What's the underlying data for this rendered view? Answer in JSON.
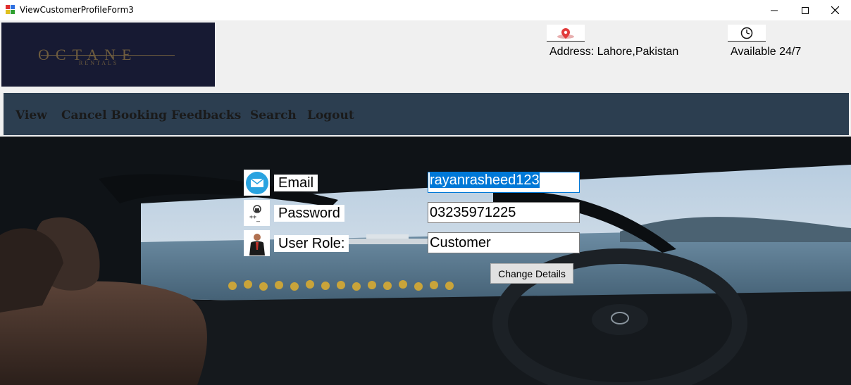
{
  "window": {
    "title": "ViewCustomerProfileForm3"
  },
  "header": {
    "logo": {
      "word": "OCTANE",
      "sub": "RENTALS"
    },
    "address_label": "Address: Lahore,Pakistan",
    "availability_label": "Available 24/7"
  },
  "menu": {
    "items": [
      {
        "label": "View"
      },
      {
        "label": "Cancel Booking"
      },
      {
        "label": "Feedbacks"
      },
      {
        "label": "Search"
      },
      {
        "label": "Logout"
      }
    ]
  },
  "form": {
    "email": {
      "label": "Email",
      "value": "rayanrasheed123"
    },
    "password": {
      "label": "Password",
      "value": "03235971225"
    },
    "role": {
      "label": "User Role:",
      "value": "Customer"
    },
    "change_button": "Change Details"
  },
  "colors": {
    "menu_bg": "#2c3e50",
    "logo_bg": "#171a33",
    "selection": "#0078d7"
  }
}
